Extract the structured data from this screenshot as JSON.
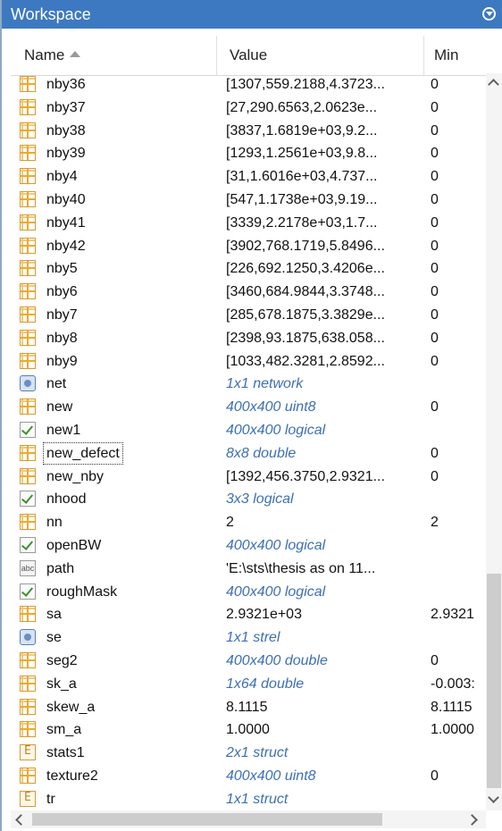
{
  "titlebar": {
    "title": "Workspace",
    "menu_icon": "chevron-down-circle-icon"
  },
  "columns": {
    "name": "Name",
    "value": "Value",
    "min": "Min",
    "sort_icon": "sort-ascending-icon"
  },
  "colors": {
    "titlebar": "#3d79c0",
    "info_text": "#3d6fb5"
  },
  "rows": [
    {
      "name": "nby36",
      "value": "[1307,559.2188,4.3723...",
      "min": "0",
      "icon": "matrix-icon",
      "info": false
    },
    {
      "name": "nby37",
      "value": "[27,290.6563,2.0623e...",
      "min": "0",
      "icon": "matrix-icon",
      "info": false
    },
    {
      "name": "nby38",
      "value": "[3837,1.6819e+03,9.2...",
      "min": "0",
      "icon": "matrix-icon",
      "info": false
    },
    {
      "name": "nby39",
      "value": "[1293,1.2561e+03,9.8...",
      "min": "0",
      "icon": "matrix-icon",
      "info": false
    },
    {
      "name": "nby4",
      "value": "[31,1.6016e+03,4.737...",
      "min": "0",
      "icon": "matrix-icon",
      "info": false
    },
    {
      "name": "nby40",
      "value": "[547,1.1738e+03,9.19...",
      "min": "0",
      "icon": "matrix-icon",
      "info": false
    },
    {
      "name": "nby41",
      "value": "[3339,2.2178e+03,1.7...",
      "min": "0",
      "icon": "matrix-icon",
      "info": false
    },
    {
      "name": "nby42",
      "value": "[3902,768.1719,5.8496...",
      "min": "0",
      "icon": "matrix-icon",
      "info": false
    },
    {
      "name": "nby5",
      "value": "[226,692.1250,3.4206e...",
      "min": "0",
      "icon": "matrix-icon",
      "info": false
    },
    {
      "name": "nby6",
      "value": "[3460,684.9844,3.3748...",
      "min": "0",
      "icon": "matrix-icon",
      "info": false
    },
    {
      "name": "nby7",
      "value": "[285,678.1875,3.3829e...",
      "min": "0",
      "icon": "matrix-icon",
      "info": false
    },
    {
      "name": "nby8",
      "value": "[2398,93.1875,638.058...",
      "min": "0",
      "icon": "matrix-icon",
      "info": false
    },
    {
      "name": "nby9",
      "value": "[1033,482.3281,2.8592...",
      "min": "0",
      "icon": "matrix-icon",
      "info": false
    },
    {
      "name": "net",
      "value": "1x1 network",
      "min": "",
      "icon": "object-icon",
      "info": true
    },
    {
      "name": "new",
      "value": "400x400 uint8",
      "min": "0",
      "icon": "matrix-icon",
      "info": true
    },
    {
      "name": "new1",
      "value": "400x400 logical",
      "min": "",
      "icon": "logical-icon",
      "info": true
    },
    {
      "name": "new_defect",
      "value": "8x8 double",
      "min": "0",
      "icon": "matrix-icon",
      "info": true,
      "focused": true
    },
    {
      "name": "new_nby",
      "value": "[1392,456.3750,2.9321...",
      "min": "0",
      "icon": "matrix-icon",
      "info": false
    },
    {
      "name": "nhood",
      "value": "3x3 logical",
      "min": "",
      "icon": "logical-icon",
      "info": true
    },
    {
      "name": "nn",
      "value": "2",
      "min": "2",
      "icon": "matrix-icon",
      "info": false
    },
    {
      "name": "openBW",
      "value": "400x400 logical",
      "min": "",
      "icon": "logical-icon",
      "info": true
    },
    {
      "name": "path",
      "value": "'E:\\sts\\thesis as on 11...",
      "min": "",
      "icon": "char-icon",
      "info": false
    },
    {
      "name": "roughMask",
      "value": "400x400 logical",
      "min": "",
      "icon": "logical-icon",
      "info": true
    },
    {
      "name": "sa",
      "value": "2.9321e+03",
      "min": "2.9321",
      "icon": "matrix-icon",
      "info": false
    },
    {
      "name": "se",
      "value": "1x1 strel",
      "min": "",
      "icon": "object-icon",
      "info": true
    },
    {
      "name": "seg2",
      "value": "400x400 double",
      "min": "0",
      "icon": "matrix-icon",
      "info": true
    },
    {
      "name": "sk_a",
      "value": "1x64 double",
      "min": "-0.003:",
      "icon": "matrix-icon",
      "info": true
    },
    {
      "name": "skew_a",
      "value": "8.1115",
      "min": "8.1115",
      "icon": "matrix-icon",
      "info": false
    },
    {
      "name": "sm_a",
      "value": "1.0000",
      "min": "1.0000",
      "icon": "matrix-icon",
      "info": false
    },
    {
      "name": "stats1",
      "value": "2x1 struct",
      "min": "",
      "icon": "struct-icon",
      "info": true
    },
    {
      "name": "texture2",
      "value": "400x400 uint8",
      "min": "0",
      "icon": "matrix-icon",
      "info": true
    },
    {
      "name": "tr",
      "value": "1x1 struct",
      "min": "",
      "icon": "struct-icon",
      "info": true
    }
  ],
  "char_icon_text": "abc"
}
